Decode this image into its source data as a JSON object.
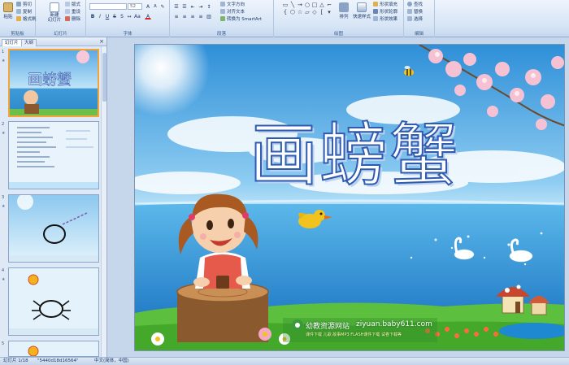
{
  "ribbon": {
    "clipboard": {
      "paste": "粘贴",
      "cut": "剪切",
      "copy": "复制",
      "format_painter": "格式刷",
      "label": "剪贴板"
    },
    "slides": {
      "new_slide": "新建\n幻灯片",
      "layout": "版式",
      "reset": "重设",
      "delete": "删除",
      "label": "幻灯片"
    },
    "font": {
      "font_name": "",
      "font_size": "52",
      "label": "字体"
    },
    "paragraph": {
      "text_direction": "文字方向",
      "align_text": "对齐文本",
      "smartart": "转换为 SmartArt",
      "label": "段落"
    },
    "drawing": {
      "arrange": "排列",
      "quick_styles": "快速样式",
      "shape_fill": "形状填充",
      "shape_outline": "形状轮廓",
      "shape_effects": "形状效果",
      "label": "绘图"
    },
    "editing": {
      "find": "查找",
      "replace": "替换",
      "select": "选择",
      "label": "编辑"
    }
  },
  "panel": {
    "tab_slides": "幻灯片",
    "tab_outline": "大纲",
    "close": "×",
    "thumbs": [
      {
        "num": "1"
      },
      {
        "num": "2"
      },
      {
        "num": "3"
      },
      {
        "num": "4"
      },
      {
        "num": "5"
      }
    ]
  },
  "slide": {
    "title": "画螃蟹",
    "site_name": "幼教资源网站",
    "site_url": "ziyuan.baby611.com",
    "site_sub": "课件下载  儿歌  故事MP3  FLASH课件下载  试卷下载等"
  },
  "thumb1_title": "画螃蟹",
  "status": {
    "slide_info": "幻灯片 1/18",
    "theme": "\"5440d18d16564\"",
    "language": "中文(简体，中国)"
  },
  "colors": {
    "ribbon_bg": "#d7e5f6",
    "selection": "#f3a637",
    "title_fill": "#ffffff",
    "title_stroke": "#2f5bb0"
  }
}
